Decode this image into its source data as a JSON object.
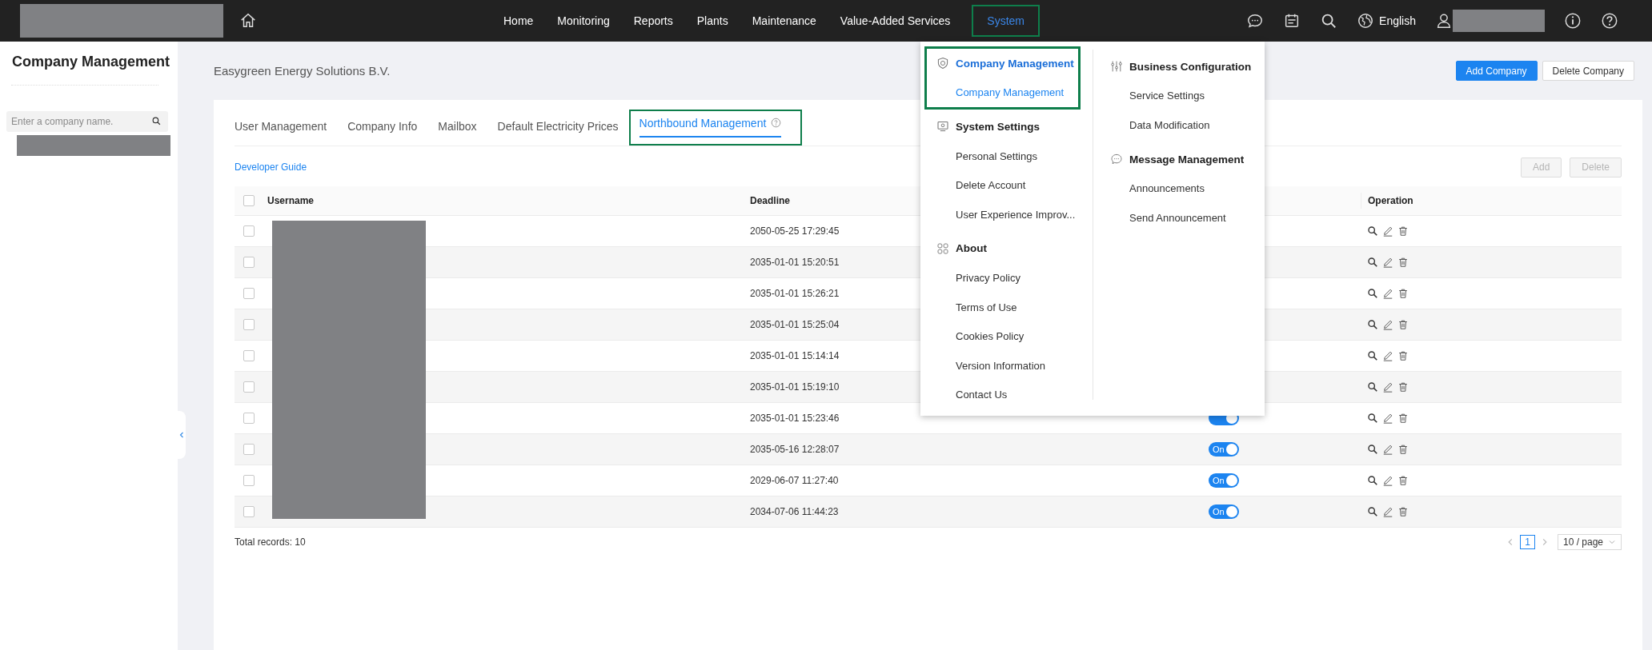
{
  "top_nav": {
    "items": [
      {
        "label": "Home",
        "selected": false,
        "highlighted": false
      },
      {
        "label": "Monitoring",
        "selected": false,
        "highlighted": false
      },
      {
        "label": "Reports",
        "selected": false,
        "highlighted": false
      },
      {
        "label": "Plants",
        "selected": false,
        "highlighted": false
      },
      {
        "label": "Maintenance",
        "selected": false,
        "highlighted": false
      },
      {
        "label": "Value-Added Services",
        "selected": false,
        "highlighted": false
      },
      {
        "label": "System",
        "selected": true,
        "highlighted": true
      }
    ],
    "language": "English"
  },
  "sidebar": {
    "title": "Company Management",
    "search": {
      "placeholder": "Enter a company name."
    }
  },
  "header": {
    "company_name": "Easygreen Energy Solutions B.V.",
    "buttons": [
      {
        "label": "Add Company",
        "kind": "primary"
      },
      {
        "label": "Delete Company",
        "kind": "default"
      }
    ]
  },
  "tabs": [
    {
      "label": "User Management",
      "selected": false,
      "highlighted": false,
      "help": false
    },
    {
      "label": "Company Info",
      "selected": false,
      "highlighted": false,
      "help": false
    },
    {
      "label": "Mailbox",
      "selected": false,
      "highlighted": false,
      "help": false
    },
    {
      "label": "Default Electricity Prices",
      "selected": false,
      "highlighted": false,
      "help": false
    },
    {
      "label": "Northbound Management",
      "selected": true,
      "highlighted": true,
      "help": true
    }
  ],
  "developer_link": "Developer Guide",
  "table_actions": [
    {
      "label": "Add",
      "disabled": true
    },
    {
      "label": "Delete",
      "disabled": true
    }
  ],
  "table": {
    "all_checked": false,
    "columns": [
      {
        "label": "Username"
      },
      {
        "label": "Deadline"
      },
      {
        "label": "Operation"
      }
    ],
    "rows": [
      {
        "checked": false,
        "deadline": "2050-05-25 17:29:45"
      },
      {
        "checked": false,
        "deadline": "2035-01-01 15:20:51"
      },
      {
        "checked": false,
        "deadline": "2035-01-01 15:26:21"
      },
      {
        "checked": false,
        "deadline": "2035-01-01 15:25:04"
      },
      {
        "checked": false,
        "deadline": "2035-01-01 15:14:14"
      },
      {
        "checked": false,
        "deadline": "2035-01-01 15:19:10"
      },
      {
        "checked": false,
        "deadline": "2035-01-01 15:23:46",
        "switch": {
          "on": true
        }
      },
      {
        "checked": false,
        "deadline": "2035-05-16 12:28:07",
        "switch": {
          "on": true,
          "label": "On"
        }
      },
      {
        "checked": false,
        "deadline": "2029-06-07 11:27:40",
        "switch": {
          "on": true,
          "label": "On"
        }
      },
      {
        "checked": false,
        "deadline": "2034-07-06 11:44:23",
        "switch": {
          "on": true,
          "label": "On"
        }
      }
    ]
  },
  "footer": {
    "total": "Total records: 10",
    "pages": [
      {
        "label": "1",
        "selected": true
      }
    ],
    "page_size": "10 / page"
  },
  "dropdown": {
    "columns": [
      {
        "groups": [
          {
            "title": "Company Management",
            "selected": true,
            "highlighted": true,
            "items": [
              {
                "label": "Company Management",
                "selected": true
              }
            ]
          },
          {
            "title": "System Settings",
            "selected": false,
            "highlighted": false,
            "items": [
              {
                "label": "Personal Settings",
                "selected": false
              },
              {
                "label": "Delete Account",
                "selected": false
              },
              {
                "label": "User Experience Improv...",
                "selected": false
              }
            ]
          },
          {
            "title": "About",
            "selected": false,
            "highlighted": false,
            "items": [
              {
                "label": "Privacy Policy",
                "selected": false
              },
              {
                "label": "Terms of Use",
                "selected": false
              },
              {
                "label": "Cookies Policy",
                "selected": false
              },
              {
                "label": "Version Information",
                "selected": false
              },
              {
                "label": "Contact Us",
                "selected": false
              }
            ]
          }
        ]
      },
      {
        "groups": [
          {
            "title": "Business Configuration",
            "selected": false,
            "highlighted": false,
            "items": [
              {
                "label": "Service Settings",
                "selected": false
              },
              {
                "label": "Data Modification",
                "selected": false
              }
            ]
          },
          {
            "title": "Message Management",
            "selected": false,
            "highlighted": false,
            "items": [
              {
                "label": "Announcements",
                "selected": false
              },
              {
                "label": "Send Announcement",
                "selected": false
              }
            ]
          }
        ]
      }
    ]
  }
}
